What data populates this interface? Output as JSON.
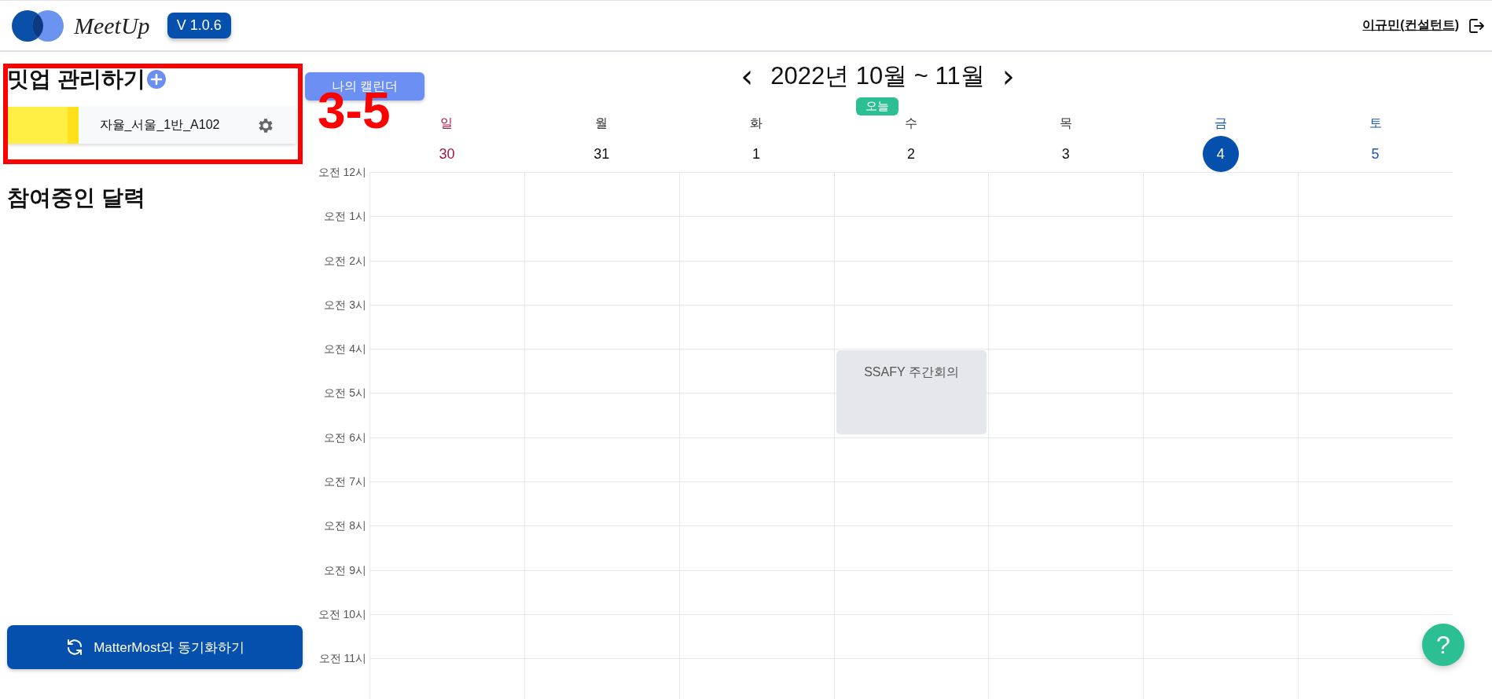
{
  "header": {
    "brand": "MeetUp",
    "version": "V 1.0.6",
    "user": "이규민(컨설턴트)"
  },
  "sidebar": {
    "manage_title": "밋업 관리하기",
    "meetups": [
      {
        "name": "자율_서울_1반_A102",
        "color": "#ffee44"
      }
    ],
    "joined_title": "참여중인 달력",
    "sync_button": "MatterMost와 동기화하기"
  },
  "annotation": {
    "label": "3-5"
  },
  "calendar": {
    "my_calendar_button": "나의 캘린더",
    "prev": "‹",
    "title": "2022년 10월 ~ 11월",
    "next": "›",
    "today_button": "오늘",
    "days": [
      {
        "weekday": "일",
        "date": "30",
        "kind": "sunday",
        "today": false
      },
      {
        "weekday": "월",
        "date": "31",
        "kind": "weekday",
        "today": false
      },
      {
        "weekday": "화",
        "date": "1",
        "kind": "weekday",
        "today": false
      },
      {
        "weekday": "수",
        "date": "2",
        "kind": "weekday",
        "today": false
      },
      {
        "weekday": "목",
        "date": "3",
        "kind": "weekday",
        "today": false
      },
      {
        "weekday": "금",
        "date": "4",
        "kind": "weekday",
        "today": true
      },
      {
        "weekday": "토",
        "date": "5",
        "kind": "saturday",
        "today": false
      }
    ],
    "hours": [
      {
        "label": "오전 12시"
      },
      {
        "label": "오전 1시"
      },
      {
        "label": "오전 2시"
      },
      {
        "label": "오전 3시"
      },
      {
        "label": "오전 4시",
        "cells": [
          {
            "kind": "empty"
          },
          {
            "kind": "empty"
          },
          {
            "kind": "empty"
          },
          {
            "kind": "event",
            "title": "SSAFY 주간회의"
          },
          {
            "kind": "empty"
          },
          {
            "kind": "empty"
          },
          {
            "kind": "empty"
          }
        ]
      },
      {
        "label": "오전 5시",
        "cells": [
          {
            "kind": "empty"
          },
          {
            "kind": "empty"
          },
          {
            "kind": "empty"
          },
          {
            "kind": "continued"
          },
          {
            "kind": "empty"
          },
          {
            "kind": "empty"
          },
          {
            "kind": "empty"
          }
        ]
      },
      {
        "label": "오전 6시"
      },
      {
        "label": "오전 7시"
      },
      {
        "label": "오전 8시"
      },
      {
        "label": "오전 9시"
      },
      {
        "label": "오전 10시"
      },
      {
        "label": "오전 11시"
      }
    ]
  },
  "help_button": "?"
}
